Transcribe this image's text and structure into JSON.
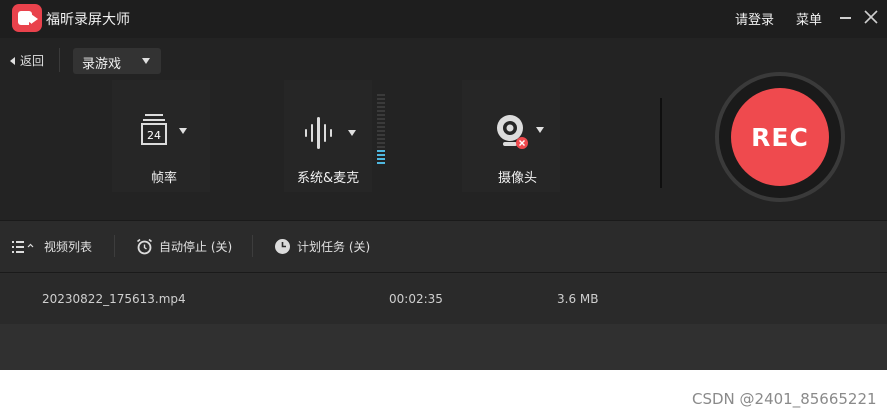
{
  "titlebar": {
    "title": "福昕录屏大师",
    "login_label": "请登录",
    "menu_label": "菜单"
  },
  "controls": {
    "back_label": "返回",
    "mode_selected": "录游戏",
    "frame_rate": {
      "label": "帧率",
      "value": "24"
    },
    "audio": {
      "label": "系统&麦克"
    },
    "camera": {
      "label": "摄像头"
    },
    "rec_label": "REC"
  },
  "toolbar": {
    "video_list_label": "视频列表",
    "auto_stop_label": "自动停止 (关)",
    "schedule_label": "计划任务 (关)"
  },
  "files": [
    {
      "name": "20230822_175613.mp4",
      "duration": "00:02:35",
      "size": "3.6 MB"
    }
  ],
  "watermark": "CSDN @2401_85665221",
  "colors": {
    "accent": "#ef4a4e",
    "logo": "#e9424c",
    "vu_meter": "#4fb8e0"
  }
}
